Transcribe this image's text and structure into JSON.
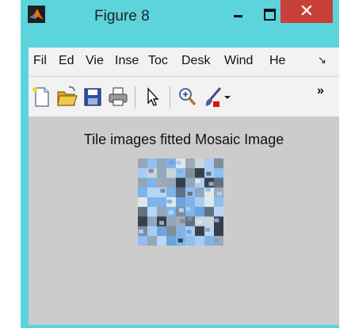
{
  "window": {
    "title": "Figure 8",
    "close_glyph": "✕",
    "icons": {
      "app": "matlab-logo-icon",
      "minimize": "minimize-icon",
      "maximize": "maximize-icon",
      "close": "close-icon"
    }
  },
  "menubar": {
    "items": [
      "Fil",
      "Ed",
      "Vie",
      "Inse",
      "Toc",
      "Desk",
      "Wind",
      "He"
    ],
    "overflow_glyph": "↘"
  },
  "toolbar": {
    "buttons": [
      "new-file-icon",
      "open-folder-icon",
      "save-icon",
      "print-icon",
      "pointer-arrow-icon",
      "zoom-in-icon",
      "brush-icon",
      "chevron-down-icon"
    ],
    "overflow_label": "»"
  },
  "figure": {
    "axes_title": "Tile images fitted Mosaic Image"
  },
  "colors": {
    "window_frame": "#5cd4dc",
    "close_button": "#c7413a",
    "figure_background": "#cccccc",
    "toolbar_background": "#f2f2f2"
  }
}
